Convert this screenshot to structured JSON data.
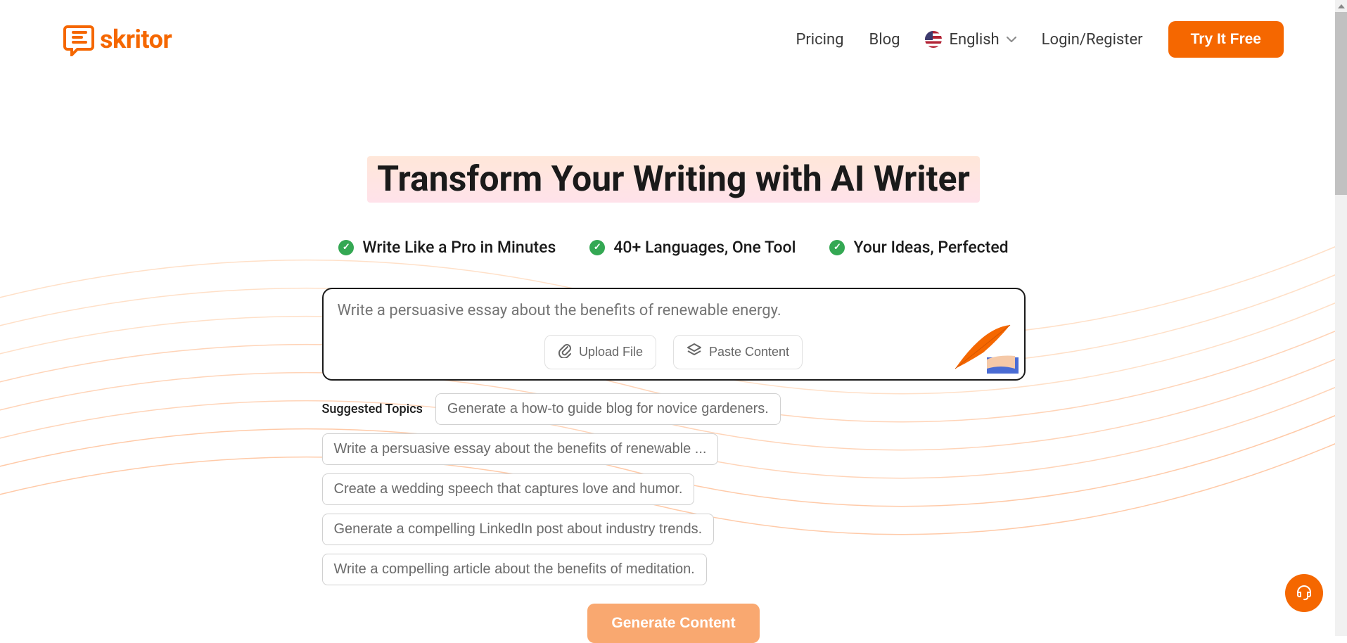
{
  "header": {
    "logo_text": "skritor",
    "nav": {
      "pricing": "Pricing",
      "blog": "Blog",
      "language": "English",
      "login": "Login/Register",
      "try_free": "Try It Free"
    }
  },
  "hero": {
    "title": "Transform Your Writing with AI Writer",
    "features": [
      "Write Like a Pro in Minutes",
      "40+ Languages, One Tool",
      "Your Ideas, Perfected"
    ]
  },
  "input": {
    "placeholder": "Write a persuasive essay about the benefits of renewable energy.",
    "upload_label": "Upload File",
    "paste_label": "Paste Content"
  },
  "suggested": {
    "label": "Suggested Topics",
    "topics": [
      "Generate a how-to guide blog for novice gardeners.",
      "Write a persuasive essay about the benefits of renewable ...",
      "Create a wedding speech that captures love and humor.",
      "Generate a compelling LinkedIn post about industry trends.",
      "Write a compelling article about the benefits of meditation."
    ]
  },
  "cta": {
    "generate": "Generate Content"
  }
}
